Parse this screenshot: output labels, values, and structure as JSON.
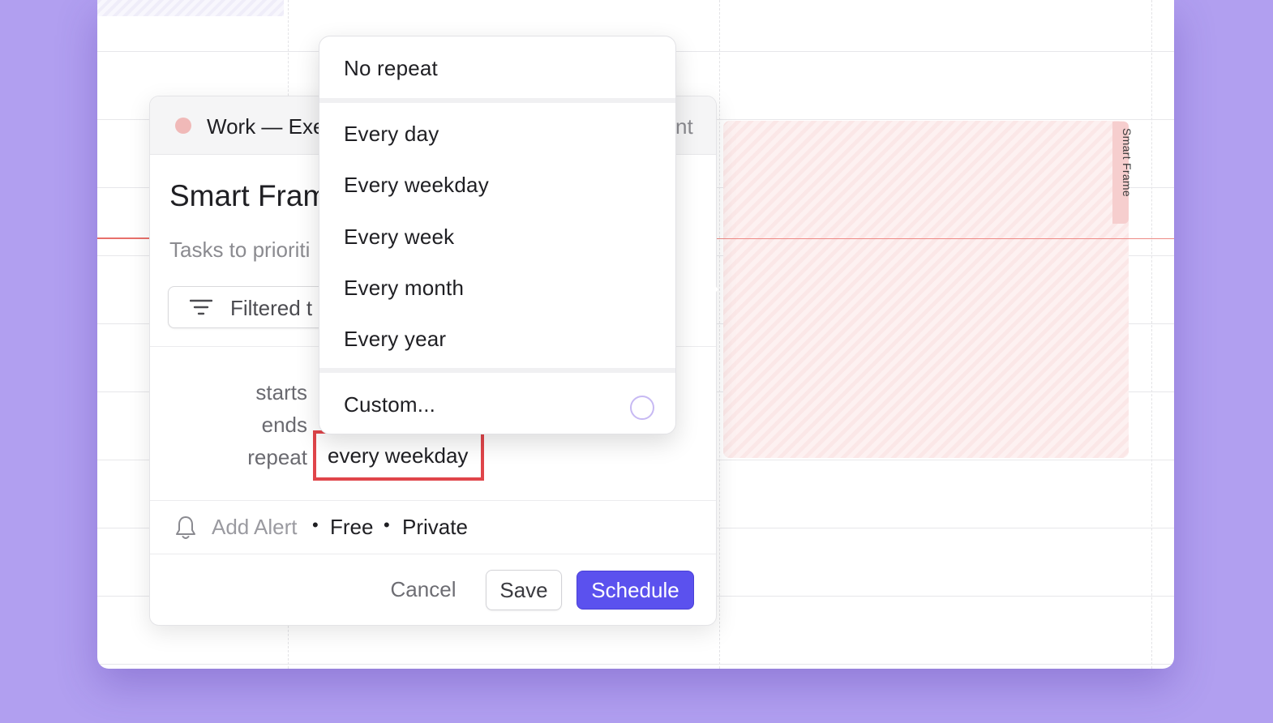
{
  "calendar_grid": {
    "event_block_label": "Smart Frame"
  },
  "event_card": {
    "calendar_name": "Work — Exe",
    "header_right_text": "nt",
    "title": "Smart Fram",
    "description": "Tasks to prioriti",
    "filter_button_label": "Filtered t",
    "fields": {
      "starts_label": "starts",
      "ends_label": "ends",
      "repeat_label": "repeat",
      "repeat_value": "every weekday"
    },
    "footer": {
      "add_alert": "Add Alert",
      "separator": "•",
      "availability": "Free",
      "visibility": "Private"
    },
    "actions": {
      "cancel": "Cancel",
      "save": "Save",
      "schedule": "Schedule"
    },
    "colors": {
      "calendar_dot": "#f0b9b8",
      "schedule_button": "#5b51ee",
      "highlight_border": "#e0454a"
    }
  },
  "repeat_menu": {
    "groups": [
      [
        "No repeat"
      ],
      [
        "Every day",
        "Every weekday",
        "Every week",
        "Every month",
        "Every year"
      ],
      [
        "Custom..."
      ]
    ],
    "no_repeat": "No repeat",
    "every_day": "Every day",
    "every_weekday": "Every weekday",
    "every_week": "Every week",
    "every_month": "Every month",
    "every_year": "Every year",
    "custom": "Custom...",
    "custom_icon": "loading-spinner-icon"
  }
}
